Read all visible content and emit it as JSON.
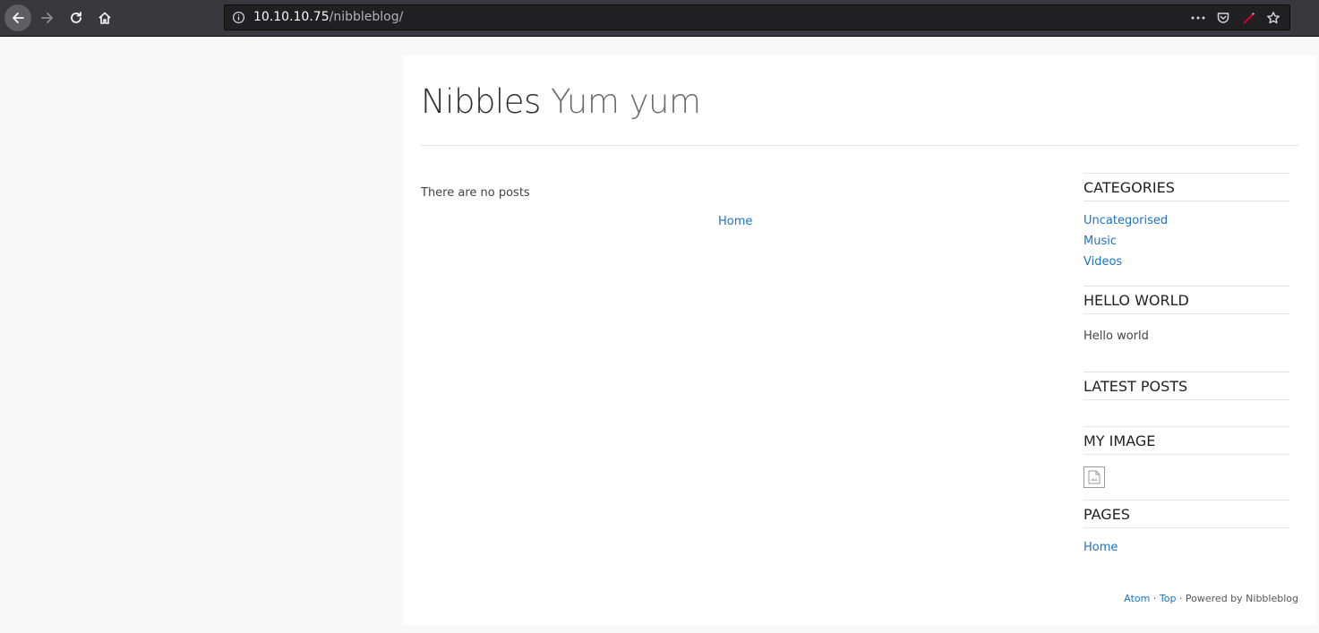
{
  "browser": {
    "url_host": "10.10.10.75",
    "url_path": "/nibbleblog/",
    "icons": [
      "back-icon",
      "forward-icon",
      "reload-icon",
      "home-icon",
      "info-icon",
      "more-icon",
      "pocket-icon",
      "pen-icon",
      "bookmark-star-icon"
    ]
  },
  "header": {
    "title": "Nibbles",
    "slogan": "Yum yum"
  },
  "main": {
    "no_posts": "There are no posts",
    "pager_home": "Home"
  },
  "sidebar": {
    "categories": {
      "title": "CATEGORIES",
      "items": [
        "Uncategorised",
        "Music",
        "Videos"
      ]
    },
    "hello_world": {
      "title": "HELLO WORLD",
      "text": "Hello world"
    },
    "latest_posts": {
      "title": "LATEST POSTS"
    },
    "my_image": {
      "title": "MY IMAGE"
    },
    "pages": {
      "title": "PAGES",
      "items": [
        "Home"
      ]
    }
  },
  "footer": {
    "atom": "Atom",
    "sep1": " · ",
    "top": "Top",
    "powered": " · Powered by Nibbleblog"
  },
  "colors": {
    "link": "#1a73c8",
    "toolbar": "#38383d",
    "urlbar": "#202023"
  }
}
